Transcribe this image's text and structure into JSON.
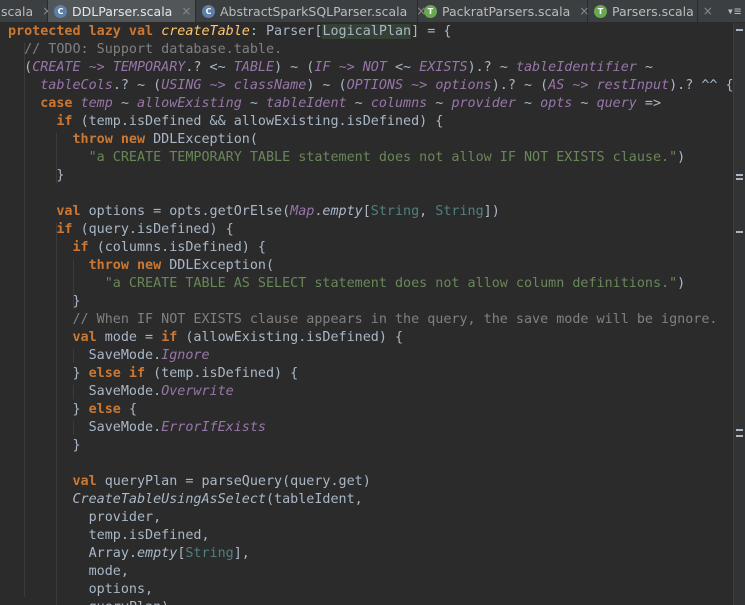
{
  "tabs": [
    {
      "label": "scala",
      "icon": "none",
      "active": false
    },
    {
      "label": "DDLParser.scala",
      "icon": "scala-class-icon",
      "active": true
    },
    {
      "label": "AbstractSparkSQLParser.scala",
      "icon": "scala-class-icon",
      "active": false
    },
    {
      "label": "PackratParsers.scala",
      "icon": "scala-trait-icon",
      "active": false
    },
    {
      "label": "Parsers.scala",
      "icon": "scala-trait-icon",
      "active": false
    }
  ],
  "tab_close_glyph": "×",
  "tab_menu_glyph": "▾≡",
  "colors": {
    "background": "#2b2b2b",
    "keyword": "#cc7832",
    "string": "#6a8759",
    "comment": "#808080",
    "identifier": "#9876aa",
    "plain": "#a9b7c6"
  },
  "code": [
    [
      [
        "kw",
        "protected lazy val "
      ],
      [
        "fn",
        "createTable"
      ],
      [
        "p",
        ": Parser["
      ],
      [
        "bx",
        "LogicalPlan"
      ],
      [
        "p",
        "] = {"
      ]
    ],
    [
      [
        "p",
        "  "
      ],
      [
        "cm",
        "// TODO: Support database.table."
      ]
    ],
    [
      [
        "p",
        "  ("
      ],
      [
        "it",
        "CREATE"
      ],
      [
        "p",
        " "
      ],
      [
        "it",
        "~>"
      ],
      [
        "p",
        " "
      ],
      [
        "it",
        "TEMPORARY"
      ],
      [
        "p",
        ".? <~ "
      ],
      [
        "it",
        "TABLE"
      ],
      [
        "p",
        ") ~ ("
      ],
      [
        "it",
        "IF"
      ],
      [
        "p",
        " "
      ],
      [
        "it",
        "~>"
      ],
      [
        "p",
        " "
      ],
      [
        "it",
        "NOT"
      ],
      [
        "p",
        " <~ "
      ],
      [
        "it",
        "EXISTS"
      ],
      [
        "p",
        ").? ~ "
      ],
      [
        "it",
        "tableIdentifier"
      ],
      [
        "p",
        " ~"
      ]
    ],
    [
      [
        "p",
        "    "
      ],
      [
        "it",
        "tableCols"
      ],
      [
        "p",
        ".? ~ ("
      ],
      [
        "it",
        "USING"
      ],
      [
        "p",
        " "
      ],
      [
        "it",
        "~>"
      ],
      [
        "p",
        " "
      ],
      [
        "it",
        "className"
      ],
      [
        "p",
        ") ~ ("
      ],
      [
        "it",
        "OPTIONS"
      ],
      [
        "p",
        " "
      ],
      [
        "it",
        "~>"
      ],
      [
        "p",
        " "
      ],
      [
        "it",
        "options"
      ],
      [
        "p",
        ").? ~ ("
      ],
      [
        "it",
        "AS"
      ],
      [
        "p",
        " "
      ],
      [
        "it",
        "~>"
      ],
      [
        "p",
        " "
      ],
      [
        "it",
        "restInput"
      ],
      [
        "p",
        ").? ^^ {"
      ]
    ],
    [
      [
        "p",
        "    "
      ],
      [
        "kw",
        "case "
      ],
      [
        "it",
        "temp"
      ],
      [
        "p",
        " ~ "
      ],
      [
        "it",
        "allowExisting"
      ],
      [
        "p",
        " ~ "
      ],
      [
        "it",
        "tableIdent"
      ],
      [
        "p",
        " ~ "
      ],
      [
        "it",
        "columns"
      ],
      [
        "p",
        " ~ "
      ],
      [
        "it",
        "provider"
      ],
      [
        "p",
        " ~ "
      ],
      [
        "it",
        "opts"
      ],
      [
        "p",
        " ~ "
      ],
      [
        "it",
        "query"
      ],
      [
        "p",
        " =>"
      ]
    ],
    [
      [
        "p",
        "      "
      ],
      [
        "kw",
        "if "
      ],
      [
        "p",
        "(temp.isDefined && allowExisting.isDefined) {"
      ]
    ],
    [
      [
        "p",
        "        "
      ],
      [
        "kw",
        "throw new "
      ],
      [
        "p",
        "DDLException("
      ]
    ],
    [
      [
        "p",
        "          "
      ],
      [
        "st",
        "\"a CREATE TEMPORARY TABLE statement does not allow IF NOT EXISTS clause.\""
      ],
      [
        "p",
        ")"
      ]
    ],
    [
      [
        "p",
        "      }"
      ]
    ],
    [
      [
        "p",
        ""
      ]
    ],
    [
      [
        "p",
        "      "
      ],
      [
        "kw",
        "val "
      ],
      [
        "p",
        "options = opts.getOrElse("
      ],
      [
        "iv",
        "Map"
      ],
      [
        "p",
        "."
      ],
      [
        "ms",
        "empty"
      ],
      [
        "p",
        "["
      ],
      [
        "tp",
        "String"
      ],
      [
        "p",
        ", "
      ],
      [
        "tp",
        "String"
      ],
      [
        "p",
        "])"
      ]
    ],
    [
      [
        "p",
        "      "
      ],
      [
        "kw",
        "if "
      ],
      [
        "p",
        "(query.isDefined) {"
      ]
    ],
    [
      [
        "p",
        "        "
      ],
      [
        "kw",
        "if "
      ],
      [
        "p",
        "(columns.isDefined) {"
      ]
    ],
    [
      [
        "p",
        "          "
      ],
      [
        "kw",
        "throw new "
      ],
      [
        "p",
        "DDLException("
      ]
    ],
    [
      [
        "p",
        "            "
      ],
      [
        "st",
        "\"a CREATE TABLE AS SELECT statement does not allow column definitions.\""
      ],
      [
        "p",
        ")"
      ]
    ],
    [
      [
        "p",
        "        }"
      ]
    ],
    [
      [
        "p",
        "        "
      ],
      [
        "cm",
        "// When IF NOT EXISTS clause appears in the query, the save mode will be ignore."
      ]
    ],
    [
      [
        "p",
        "        "
      ],
      [
        "kw",
        "val "
      ],
      [
        "p",
        "mode = "
      ],
      [
        "kw",
        "if "
      ],
      [
        "p",
        "(allowExisting.isDefined) {"
      ]
    ],
    [
      [
        "p",
        "          SaveMode."
      ],
      [
        "iv",
        "Ignore"
      ]
    ],
    [
      [
        "p",
        "        } "
      ],
      [
        "kw",
        "else if "
      ],
      [
        "p",
        "(temp.isDefined) {"
      ]
    ],
    [
      [
        "p",
        "          SaveMode."
      ],
      [
        "iv",
        "Overwrite"
      ]
    ],
    [
      [
        "p",
        "        } "
      ],
      [
        "kw",
        "else "
      ],
      [
        "p",
        "{"
      ]
    ],
    [
      [
        "p",
        "          SaveMode."
      ],
      [
        "iv",
        "ErrorIfExists"
      ]
    ],
    [
      [
        "p",
        "        }"
      ]
    ],
    [
      [
        "p",
        ""
      ]
    ],
    [
      [
        "p",
        "        "
      ],
      [
        "kw",
        "val "
      ],
      [
        "p",
        "queryPlan = parseQuery(query.get)"
      ]
    ],
    [
      [
        "p",
        "        "
      ],
      [
        "ms",
        "CreateTableUsingAsSelect"
      ],
      [
        "p",
        "(tableIdent,"
      ]
    ],
    [
      [
        "p",
        "          provider,"
      ]
    ],
    [
      [
        "p",
        "          temp.isDefined,"
      ]
    ],
    [
      [
        "p",
        "          Array."
      ],
      [
        "ms",
        "empty"
      ],
      [
        "p",
        "["
      ],
      [
        "tp",
        "String"
      ],
      [
        "p",
        "],"
      ]
    ],
    [
      [
        "p",
        "          mode,"
      ]
    ],
    [
      [
        "p",
        "          options,"
      ]
    ],
    [
      [
        "p",
        "          queryPlan)"
      ]
    ]
  ]
}
